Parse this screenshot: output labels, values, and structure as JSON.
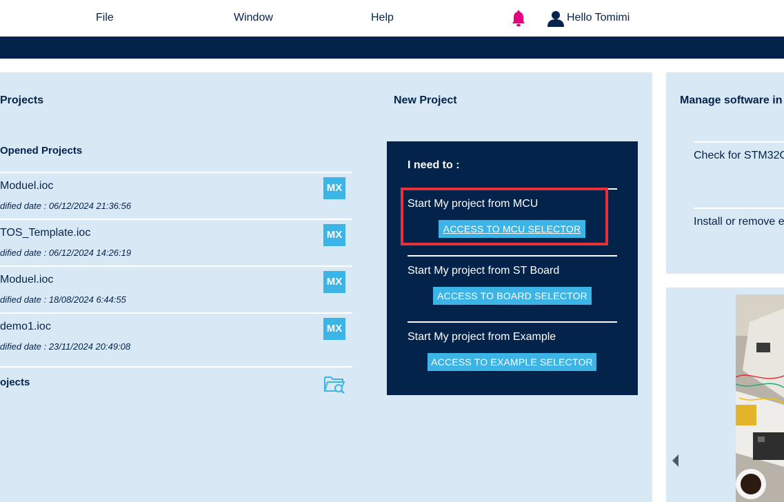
{
  "menu": {
    "file": "File",
    "window": "Window",
    "help": "Help",
    "user_greeting": "Hello Tomimi"
  },
  "colors": {
    "navy": "#03234b",
    "panel": "#d9e8f5",
    "accent": "#3cb4e6",
    "bell": "#e6007e",
    "highlight": "#e8303a"
  },
  "icons": {
    "bell": "bell-icon",
    "user": "user-icon",
    "mx": "mx-badge-icon",
    "folder": "folder-search-icon",
    "arrow": "chevron-left-icon"
  },
  "existing": {
    "title": "Projects",
    "recent_title": "Opened Projects",
    "badge": "MX",
    "projects": [
      {
        "name": "Moduel.ioc",
        "date": "dified date : 06/12/2024 21:36:56"
      },
      {
        "name": "TOS_Template.ioc",
        "date": "dified date : 06/12/2024 14:26:19"
      },
      {
        "name": "Moduel.ioc",
        "date": "dified date : 18/08/2024 6:44:55"
      },
      {
        "name": "demo1.ioc",
        "date": "dified date : 23/11/2024 20:49:08"
      }
    ],
    "other_label": "ojects"
  },
  "new_project": {
    "title": "New Project",
    "need_to": "I need to :",
    "options": [
      {
        "label": "Start My project from MCU",
        "button": "ACCESS TO MCU SELECTOR"
      },
      {
        "label": "Start My project from ST Board",
        "button": "ACCESS TO BOARD SELECTOR"
      },
      {
        "label": "Start My project from Example",
        "button": "ACCESS TO EXAMPLE SELECTOR"
      }
    ]
  },
  "manage": {
    "title": "Manage software in",
    "items": [
      "Check for STM32C",
      "Install or remove e"
    ]
  }
}
